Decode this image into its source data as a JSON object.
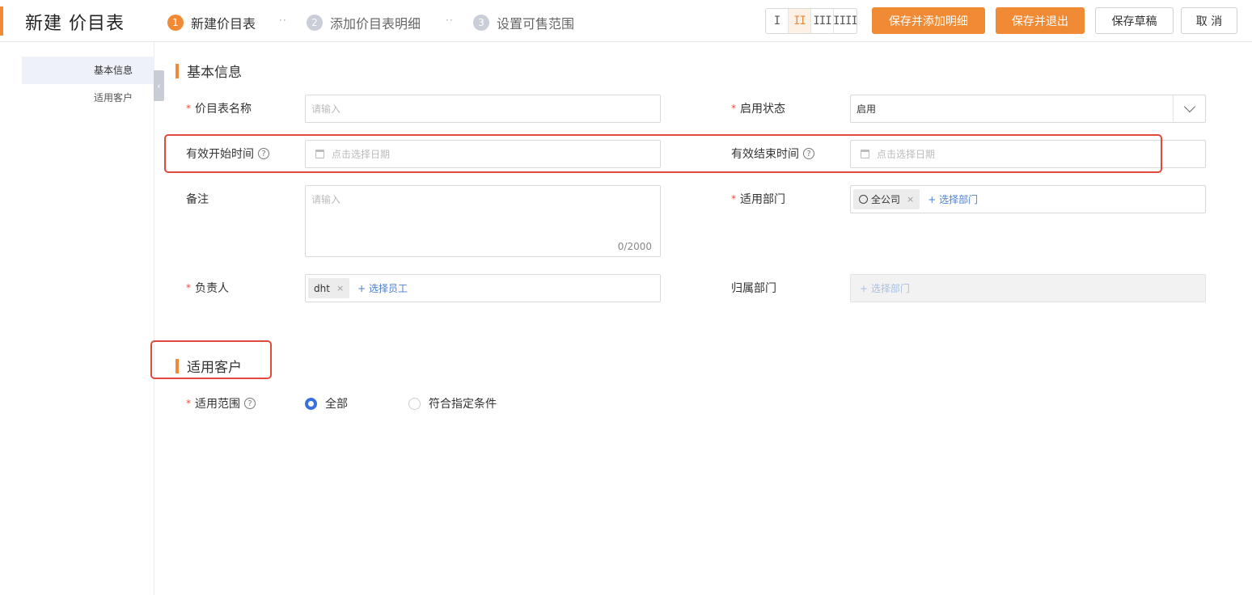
{
  "header": {
    "title": "新建 价目表",
    "steps": [
      {
        "num": "1",
        "label": "新建价目表"
      },
      {
        "num": "2",
        "label": "添加价目表明细"
      },
      {
        "num": "3",
        "label": "设置可售范围"
      }
    ],
    "step_sep": "··",
    "column_options": [
      "I",
      "II",
      "III",
      "IIII"
    ],
    "column_selected": "II",
    "buttons": {
      "save_add_detail": "保存并添加明细",
      "save_exit": "保存并退出",
      "save_draft": "保存草稿",
      "cancel": "取 消"
    }
  },
  "sidebar": {
    "items": [
      "基本信息",
      "适用客户"
    ],
    "collapse_glyph": "‹"
  },
  "basic_info": {
    "title": "基本信息",
    "name": {
      "label": "价目表名称",
      "placeholder": "请输入"
    },
    "status": {
      "label": "启用状态",
      "value": "启用"
    },
    "start_time": {
      "label": "有效开始时间",
      "placeholder": "点击选择日期"
    },
    "end_time": {
      "label": "有效结束时间",
      "placeholder": "点击选择日期"
    },
    "remark": {
      "label": "备注",
      "placeholder": "请输入",
      "counter": "0/2000"
    },
    "dept": {
      "label": "适用部门",
      "tag": "全公司",
      "add_link": "+ 选择部门"
    },
    "owner": {
      "label": "负责人",
      "tag": "dht",
      "add_link": "+ 选择员工"
    },
    "owner_dept": {
      "label": "归属部门",
      "add_link": "+ 选择部门"
    },
    "help_glyph": "?",
    "tag_remove": "×"
  },
  "customer": {
    "title": "适用客户",
    "scope_label": "适用范围",
    "options": [
      {
        "label": "全部",
        "selected": true
      },
      {
        "label": "符合指定条件",
        "selected": false
      }
    ]
  },
  "colors": {
    "accent": "#f08a35",
    "highlight": "#e04a3a",
    "link": "#4a7fd6"
  }
}
